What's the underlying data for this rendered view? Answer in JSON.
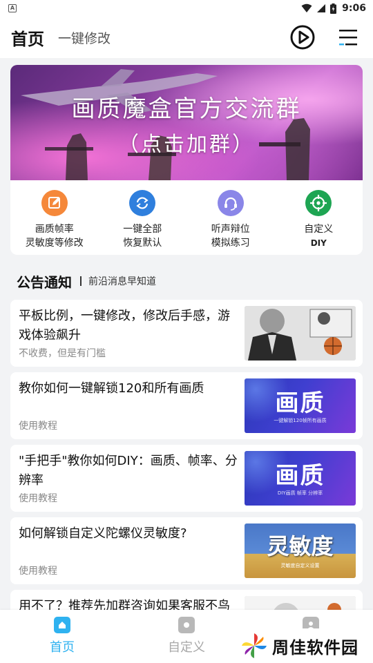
{
  "status_bar": {
    "time": "9:06"
  },
  "header": {
    "title": "首页",
    "subtitle": "一键修改"
  },
  "banner": {
    "title": "画质魔盒官方交流群",
    "subtitle": "（点击加群）"
  },
  "actions": [
    {
      "line1": "画质帧率",
      "line2": "灵敏度等修改",
      "icon": "edit-icon",
      "color": "#f5883a"
    },
    {
      "line1": "一键全部",
      "line2": "恢复默认",
      "icon": "refresh-icon",
      "color": "#2f7fdd"
    },
    {
      "line1": "听声辩位",
      "line2": "模拟练习",
      "icon": "headset-icon",
      "color": "#8a86e8"
    },
    {
      "line1": "自定义",
      "line2": "DIY",
      "icon": "crosshair-icon",
      "color": "#1ea553"
    }
  ],
  "section": {
    "title": "公告通知",
    "subtitle": "前沿消息早知道"
  },
  "news": [
    {
      "title": "平板比例，一键修改，修改后手感，游戏体验飙升",
      "tag": "不收费，但是有门槛"
    },
    {
      "title": "教你如何一键解锁120和所有画质",
      "tag": "使用教程",
      "thumb_big": "画质",
      "thumb_small": "一键解锁120帧所有画质"
    },
    {
      "title": "\"手把手\"教你如何DIY：画质、帧率、分辨率",
      "tag": "使用教程",
      "thumb_big": "画质",
      "thumb_small": "DIY画质 帧率 分辨率"
    },
    {
      "title": "如何解锁自定义陀螺仪灵敏度?",
      "tag": "使用教程",
      "thumb_big": "灵敏度",
      "thumb_small": "灵敏度自定义设置"
    },
    {
      "title": "用不了？推荐先加群咨询如果客服不鸟",
      "tag": ""
    }
  ],
  "bottom_nav": [
    {
      "label": "首页",
      "active": true
    },
    {
      "label": "自定义",
      "active": false
    },
    {
      "label": "",
      "active": false
    }
  ],
  "watermark": {
    "text": "周佳软件园"
  },
  "colors": {
    "accent": "#2fb2f0",
    "background": "#f2f3f5"
  }
}
